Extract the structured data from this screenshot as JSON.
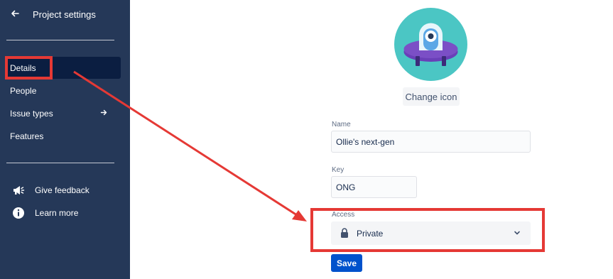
{
  "sidebar": {
    "back_label": "Project settings",
    "items": [
      {
        "label": "Details",
        "active": true
      },
      {
        "label": "People"
      },
      {
        "label": "Issue types",
        "has_arrow": true
      },
      {
        "label": "Features"
      }
    ],
    "utility": [
      {
        "label": "Give feedback",
        "icon": "megaphone-icon"
      },
      {
        "label": "Learn more",
        "icon": "info-icon"
      }
    ]
  },
  "main": {
    "change_icon_label": "Change icon",
    "name": {
      "label": "Name",
      "value": "Ollie's next-gen"
    },
    "key": {
      "label": "Key",
      "value": "ONG"
    },
    "access": {
      "label": "Access",
      "value": "Private",
      "icon": "lock-icon"
    },
    "save_label": "Save"
  },
  "colors": {
    "sidebar_bg": "#253858",
    "active_item_bg": "#0b1e41",
    "primary_button": "#0052cc",
    "annotation": "#e53935",
    "avatar_bg": "#4bc6c4",
    "avatar_ufo": "#7b4fc6"
  }
}
